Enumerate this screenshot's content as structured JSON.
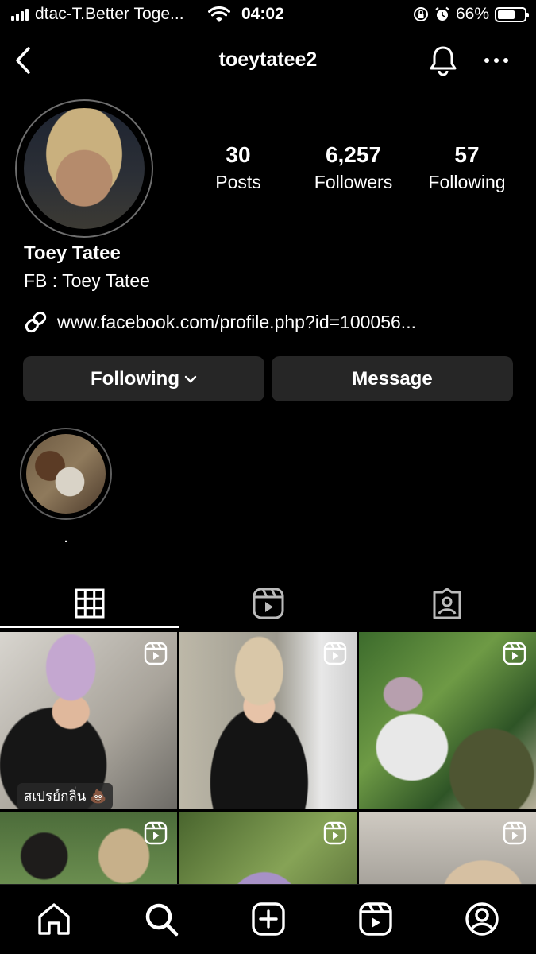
{
  "status_bar": {
    "carrier": "dtac-T.Better Toge...",
    "time": "04:02",
    "battery": "66%",
    "battery_level": 0.66,
    "icons": [
      "signal-icon",
      "wifi-icon",
      "orientation-lock-icon",
      "alarm-icon",
      "battery-icon"
    ]
  },
  "header": {
    "username": "toeytatee2",
    "icons": [
      "back-chevron-icon",
      "bell-icon",
      "more-icon"
    ]
  },
  "profile": {
    "display_name": "Toey Tatee",
    "bio": "FB : Toey Tatee",
    "link": "www.facebook.com/profile.php?id=100056...",
    "stats": {
      "posts_count": "30",
      "posts_label": "Posts",
      "followers_count": "6,257",
      "followers_label": "Followers",
      "following_count": "57",
      "following_label": "Following"
    }
  },
  "actions": {
    "following_label": "Following",
    "message_label": "Message"
  },
  "highlights": [
    {
      "label": "."
    }
  ],
  "tabs": [
    "grid-icon",
    "reels-icon",
    "tagged-icon"
  ],
  "posts": [
    {
      "type": "reel",
      "caption": "สเปรย์กลิ่น 💩"
    },
    {
      "type": "reel",
      "caption": ""
    },
    {
      "type": "reel",
      "caption": ""
    },
    {
      "type": "reel",
      "caption": ""
    },
    {
      "type": "reel",
      "caption": ""
    },
    {
      "type": "reel",
      "caption": ""
    }
  ],
  "bottom_nav": [
    "home-icon",
    "search-icon",
    "add-post-icon",
    "reels-icon",
    "profile-icon"
  ],
  "colors": {
    "background": "#000000",
    "button_bg": "#262626",
    "text": "#ffffff"
  }
}
